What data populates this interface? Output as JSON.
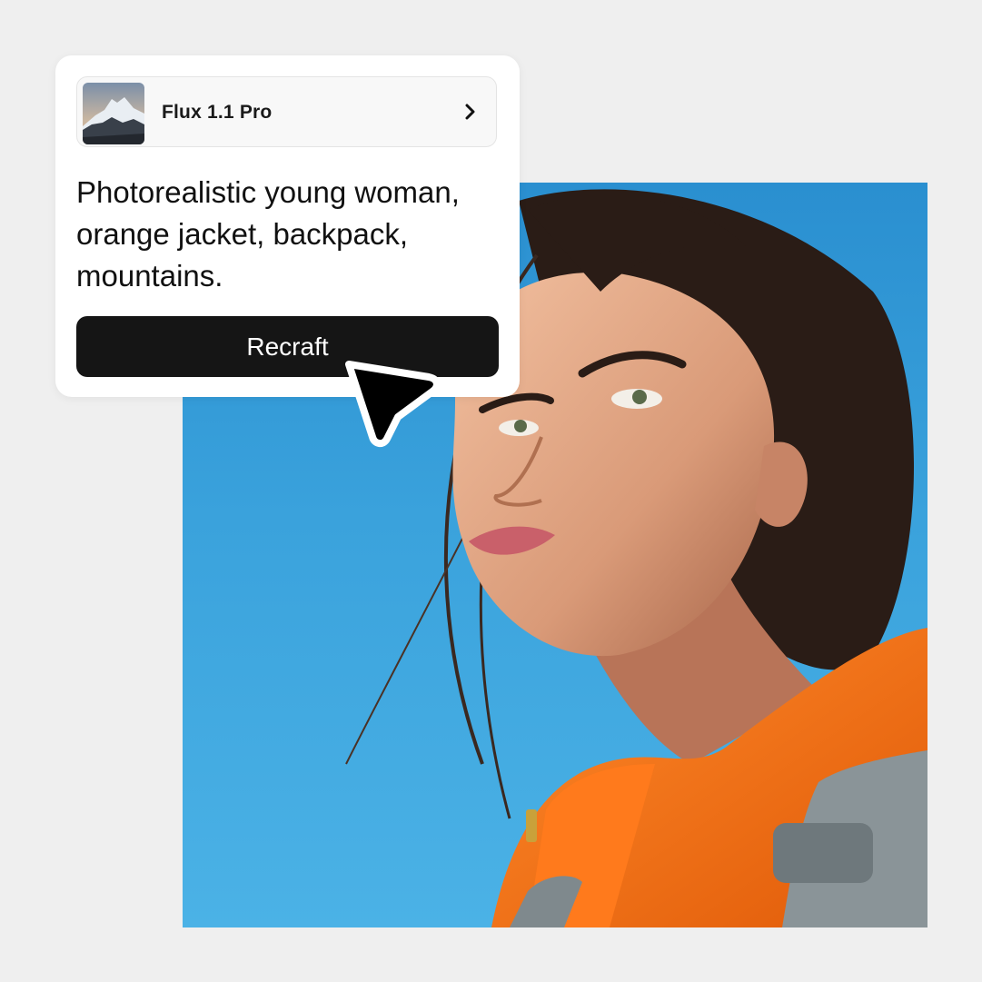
{
  "model": {
    "name": "Flux 1.1 Pro",
    "thumbnail_icon": "mountain-thumbnail",
    "chevron_icon": "chevron-right-icon"
  },
  "prompt": {
    "line1": "Photorealistic young woman,",
    "line2": "orange jacket, backpack,",
    "line3": "mountains."
  },
  "action": {
    "label": "Recraft"
  },
  "colors": {
    "background": "#efefef",
    "card": "#ffffff",
    "button": "#151515",
    "button_text": "#ffffff",
    "sky": "#3aa2dc",
    "jacket": "#f26a12"
  },
  "cursor_icon": "arrow-cursor-icon",
  "image_subject": "generated-photo"
}
